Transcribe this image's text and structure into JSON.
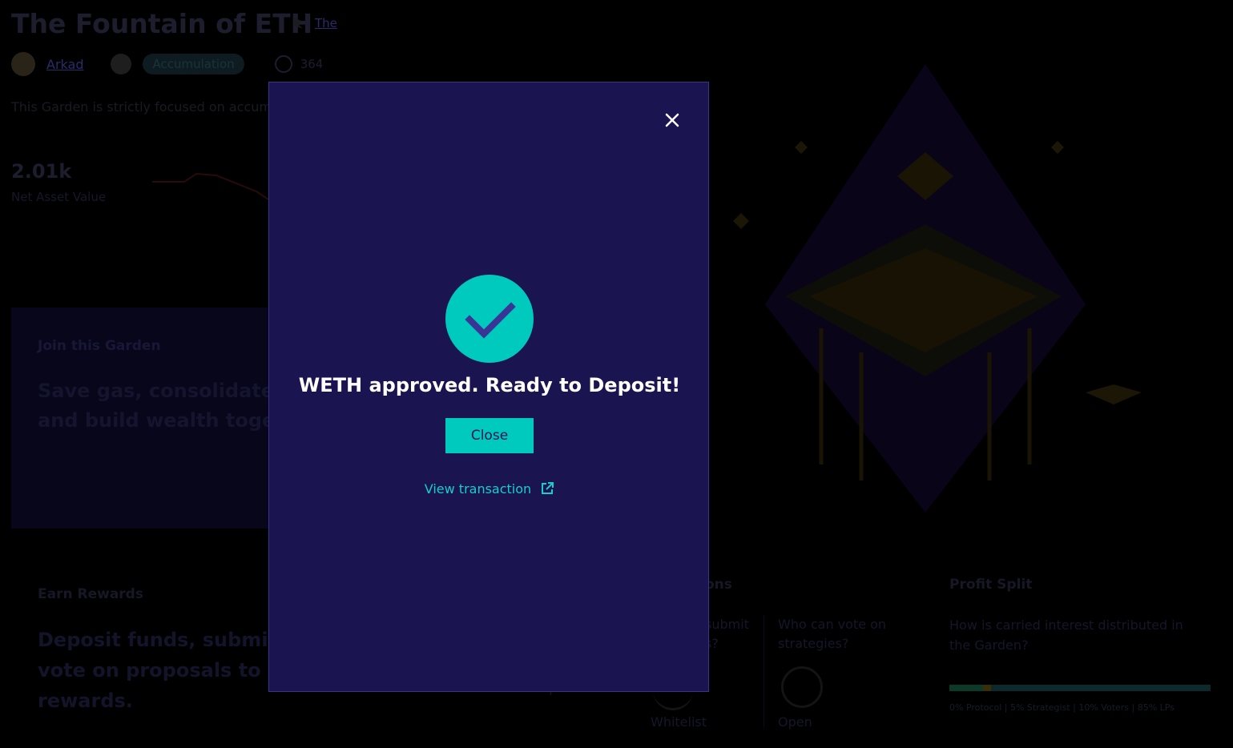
{
  "garden": {
    "title": "The Fountain of ETH",
    "title_link": "The",
    "manager": "Arkad",
    "strategy": "Accumulation",
    "members": "364",
    "description": "This Garden is strictly focused on accum",
    "nav_value": "2.01k",
    "nav_label": "Net Asset Value"
  },
  "join": {
    "title": "Join this Garden",
    "line1": "Save gas, consolidate y",
    "line2": "and build wealth togeth"
  },
  "rewards": {
    "title": "Earn Rewards",
    "line1": "Deposit funds, submit s",
    "line2": "vote on proposals to ea",
    "line3": "rewards."
  },
  "governance": {
    "title": "ons",
    "q1": "submit s?",
    "q2": "Who can vote on strategies?",
    "v1": "Whitelist",
    "v2": "Open",
    "frag": "i"
  },
  "profit": {
    "title": "Profit Split",
    "question": "How is carried interest distributed in the Garden?",
    "legend": "0% Protocol | 5% Strategist | 10% Voters | 85% LPs",
    "colors": [
      "#0b3a2a",
      "#3a2e06",
      "#0c2a2c"
    ]
  },
  "modal": {
    "heading": "WETH approved. Ready to Deposit!",
    "close_label": "Close",
    "view_transaction": "View transaction",
    "accent": "#00c9be",
    "background": "#1a1450"
  }
}
